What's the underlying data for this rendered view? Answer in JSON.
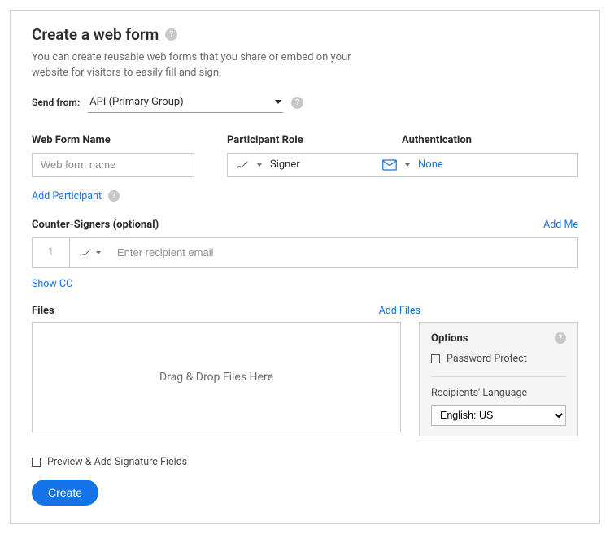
{
  "header": {
    "title": "Create a web form",
    "subtitle": "You can create reusable web forms that you share or embed on your website for visitors to easily fill and sign."
  },
  "sendFrom": {
    "label": "Send from:",
    "value": "API (Primary Group)"
  },
  "sections": {
    "webFormName": {
      "label": "Web Form Name",
      "placeholder": "Web form name"
    },
    "participantRole": {
      "label": "Participant Role",
      "value": "Signer"
    },
    "authentication": {
      "label": "Authentication",
      "value": "None"
    }
  },
  "addParticipant": {
    "label": "Add Participant"
  },
  "counterSigners": {
    "label": "Counter-Signers (optional)",
    "addMe": "Add Me",
    "number": "1",
    "placeholder": "Enter recipient email"
  },
  "showCC": "Show CC",
  "files": {
    "label": "Files",
    "addFiles": "Add Files",
    "dropzone": "Drag & Drop Files Here"
  },
  "options": {
    "title": "Options",
    "passwordProtect": "Password Protect",
    "langLabel": "Recipients' Language",
    "langValue": "English: US"
  },
  "previewAdd": "Preview & Add Signature Fields",
  "create": "Create"
}
